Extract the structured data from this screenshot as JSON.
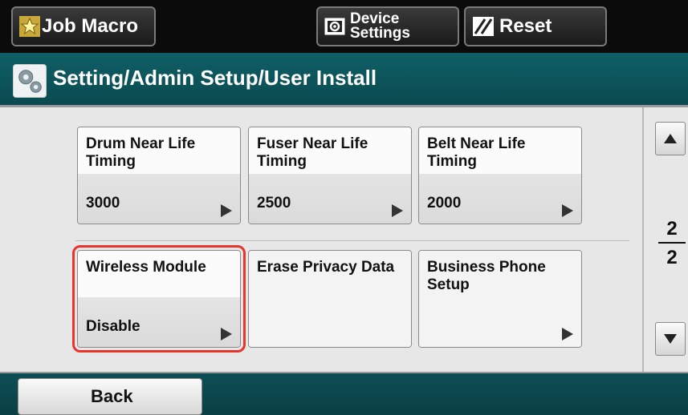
{
  "toolbar": {
    "job_macro_label": "Job Macro",
    "device_settings_line1": "Device",
    "device_settings_line2": "Settings",
    "reset_label": "Reset"
  },
  "header": {
    "title": "Setting/Admin Setup/User Install"
  },
  "tiles": [
    {
      "label": "Drum Near Life Timing",
      "value": "3000"
    },
    {
      "label": "Fuser Near Life Timing",
      "value": "2500"
    },
    {
      "label": "Belt Near Life Timing",
      "value": "2000"
    },
    {
      "label": "Wireless Module",
      "value": "Disable",
      "selected": true
    },
    {
      "label": "Erase Privacy Data",
      "value": ""
    },
    {
      "label": "Business Phone Setup",
      "value": ""
    }
  ],
  "pager": {
    "current": "2",
    "total": "2"
  },
  "footer": {
    "back_label": "Back"
  },
  "colors": {
    "title_bar": "#0f5f66",
    "selected_outline": "#e8342a",
    "tile_background": "#f4f4f4"
  },
  "icons": {
    "job_macro": "star-icon",
    "device_settings": "device-settings-icon",
    "reset": "reset-icon",
    "header": "gear-icon",
    "scroll_up": "triangle-up-icon",
    "scroll_down": "triangle-down-icon",
    "tile_arrow": "play-arrow-icon"
  }
}
